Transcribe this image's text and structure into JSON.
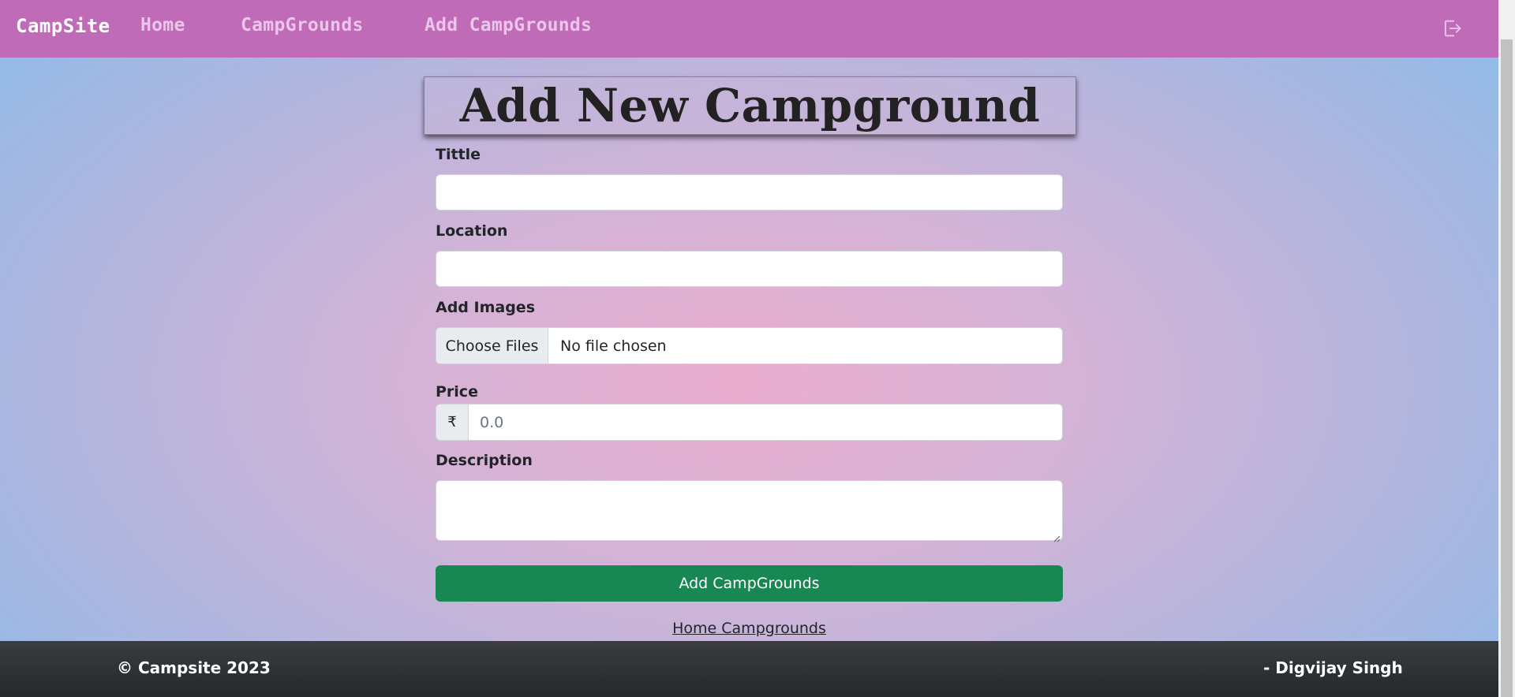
{
  "navbar": {
    "brand": "CampSite",
    "links": [
      "Home",
      "CampGrounds",
      "Add CampGrounds"
    ],
    "logout_icon": "logout-icon"
  },
  "heading": "Add New Campground",
  "form": {
    "title_label": "Tittle",
    "title_value": "",
    "location_label": "Location",
    "location_value": "",
    "images_label": "Add Images",
    "file_button": "Choose Files",
    "file_status": "No file chosen",
    "price_label": "Price",
    "currency_symbol": "₹",
    "price_placeholder": "0.0",
    "description_label": "Description",
    "description_value": "",
    "submit_label": "Add CampGrounds"
  },
  "home_link": "Home Campgrounds",
  "footer": {
    "copyright": "© Campsite 2023",
    "author": "- Digvijay Singh"
  },
  "colors": {
    "navbar": "#bf6bb7",
    "submit": "#198754",
    "footer": "#343a40"
  }
}
